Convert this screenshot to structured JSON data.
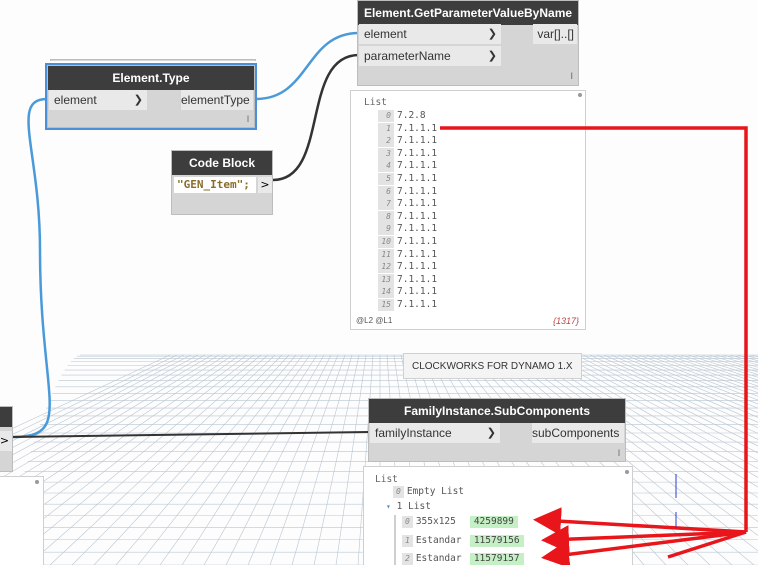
{
  "nodes": {
    "get_param": {
      "title": "Element.GetParameterValueByName",
      "inputs": [
        "element",
        "parameterName"
      ],
      "output": "var[]..[]"
    },
    "element_type": {
      "title": "Element.Type",
      "input": "element",
      "output": "elementType"
    },
    "code_block": {
      "title": "Code Block",
      "code": "\"GEN_Item\";",
      "output_arrow": ">"
    },
    "subcomponents": {
      "title": "FamilyInstance.SubComponents",
      "input": "familyInstance",
      "output": "subComponents"
    },
    "left_stub": {
      "output_arrow": ">"
    }
  },
  "preview_top": {
    "title": "List",
    "items": [
      {
        "i": "0",
        "v": "7.2.8"
      },
      {
        "i": "1",
        "v": "7.1.1.1"
      },
      {
        "i": "2",
        "v": "7.1.1.1"
      },
      {
        "i": "3",
        "v": "7.1.1.1"
      },
      {
        "i": "4",
        "v": "7.1.1.1"
      },
      {
        "i": "5",
        "v": "7.1.1.1"
      },
      {
        "i": "6",
        "v": "7.1.1.1"
      },
      {
        "i": "7",
        "v": "7.1.1.1"
      },
      {
        "i": "8",
        "v": "7.1.1.1"
      },
      {
        "i": "9",
        "v": "7.1.1.1"
      },
      {
        "i": "10",
        "v": "7.1.1.1"
      },
      {
        "i": "11",
        "v": "7.1.1.1"
      },
      {
        "i": "12",
        "v": "7.1.1.1"
      },
      {
        "i": "13",
        "v": "7.1.1.1"
      },
      {
        "i": "14",
        "v": "7.1.1.1"
      },
      {
        "i": "15",
        "v": "7.1.1.1"
      }
    ],
    "levels": "@L2 @L1",
    "count": "{1317}"
  },
  "preview_bottom": {
    "title": "List",
    "empty_index": "0",
    "empty_label": "Empty List",
    "sub_index": "1",
    "sub_label": "List",
    "items": [
      {
        "i": "0",
        "v": "355x125",
        "id": "4259899"
      },
      {
        "i": "1",
        "v": "Estandar",
        "id": "11579156"
      },
      {
        "i": "2",
        "v": "Estandar",
        "id": "11579157"
      }
    ]
  },
  "tooltip": "CLOCKWORKS FOR DYNAMO 1.X",
  "colors": {
    "wire_selected": "#4a9ad9",
    "wire": "#333333",
    "annotation": "#e8161b",
    "highlight": "#c5efc5"
  }
}
